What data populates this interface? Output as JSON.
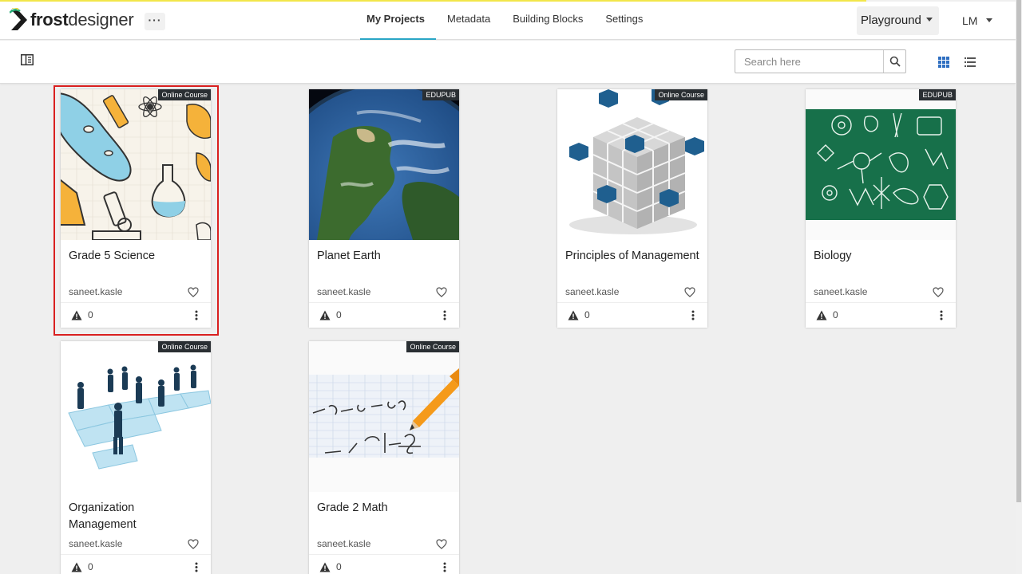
{
  "header": {
    "logo_bold": "frost",
    "logo_light": "designer",
    "more_label": "···",
    "nav_tabs": [
      {
        "label": "My Projects",
        "active": true
      },
      {
        "label": "Metadata",
        "active": false
      },
      {
        "label": "Building Blocks",
        "active": false
      },
      {
        "label": "Settings",
        "active": false
      }
    ],
    "workspace": "Playground",
    "user_initials": "LM"
  },
  "toolbar": {
    "search_placeholder": "Search here",
    "view_mode": "grid"
  },
  "colors": {
    "accent": "#2aa6c6",
    "selection": "#d92020",
    "badge_bg": "#2a2f33",
    "logo_green": "#2ab07a",
    "progress_line": "#f2e64a"
  },
  "projects": [
    {
      "title": "Grade 5 Science",
      "badge": "Online Course",
      "author": "saneet.kasle",
      "warnings": "0",
      "selected": true,
      "thumb": "science-doodles"
    },
    {
      "title": "Planet Earth",
      "badge": "EDUPUB",
      "author": "saneet.kasle",
      "warnings": "0",
      "selected": false,
      "thumb": "earth-globe"
    },
    {
      "title": "Principles of Management",
      "badge": "Online Course",
      "author": "saneet.kasle",
      "warnings": "0",
      "selected": false,
      "thumb": "cube-blocks"
    },
    {
      "title": "Biology",
      "badge": "EDUPUB",
      "author": "saneet.kasle",
      "warnings": "0",
      "selected": false,
      "thumb": "chalkboard-biology"
    },
    {
      "title": "Organization Management",
      "badge": "Online Course",
      "author": "saneet.kasle",
      "warnings": "0",
      "selected": false,
      "thumb": "puzzle-people"
    },
    {
      "title": "Grade 2 Math",
      "badge": "Online Course",
      "author": "saneet.kasle",
      "warnings": "0",
      "selected": false,
      "thumb": "math-paper"
    }
  ]
}
